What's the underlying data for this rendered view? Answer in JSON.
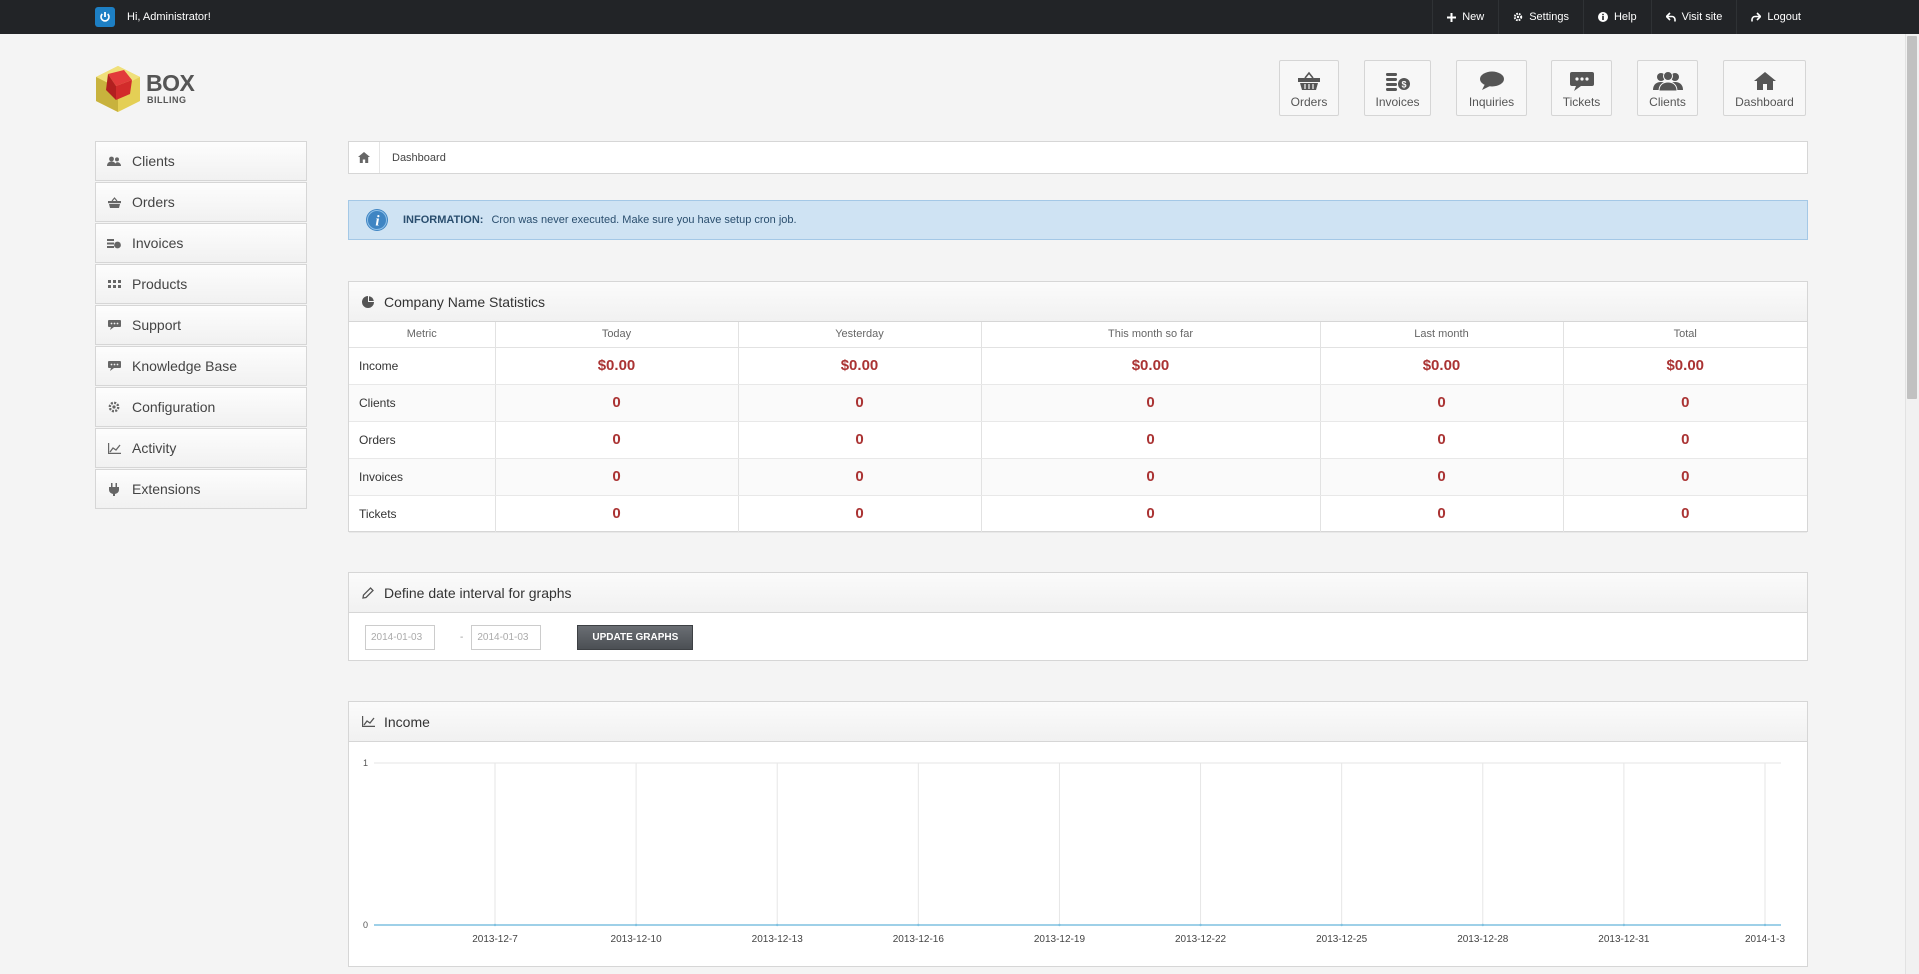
{
  "topbar": {
    "greeting": "Hi, Administrator!",
    "links": [
      {
        "label": "New",
        "icon": "plus-icon"
      },
      {
        "label": "Settings",
        "icon": "gear-icon"
      },
      {
        "label": "Help",
        "icon": "info-icon"
      },
      {
        "label": "Visit site",
        "icon": "back-arrow-icon"
      },
      {
        "label": "Logout",
        "icon": "logout-arrow-icon"
      }
    ]
  },
  "logo": {
    "line1": "BOX",
    "line2": "BILLING"
  },
  "quick_buttons": [
    {
      "label": "Orders",
      "icon": "basket-icon"
    },
    {
      "label": "Invoices",
      "icon": "coins-icon"
    },
    {
      "label": "Inquiries",
      "icon": "speech-bubble-icon"
    },
    {
      "label": "Tickets",
      "icon": "ticket-chat-icon"
    },
    {
      "label": "Clients",
      "icon": "users-icon"
    },
    {
      "label": "Dashboard",
      "icon": "home-icon"
    }
  ],
  "sidebar": {
    "items": [
      {
        "label": "Clients",
        "icon": "users-icon"
      },
      {
        "label": "Orders",
        "icon": "basket-icon"
      },
      {
        "label": "Invoices",
        "icon": "coins-icon"
      },
      {
        "label": "Products",
        "icon": "grid-icon"
      },
      {
        "label": "Support",
        "icon": "chat-icon"
      },
      {
        "label": "Knowledge Base",
        "icon": "chat-icon"
      },
      {
        "label": "Configuration",
        "icon": "gear-icon"
      },
      {
        "label": "Activity",
        "icon": "chart-line-icon"
      },
      {
        "label": "Extensions",
        "icon": "plug-icon"
      }
    ]
  },
  "breadcrumb": {
    "current": "Dashboard"
  },
  "info": {
    "label": "INFORMATION:",
    "message": "Cron was never executed. Make sure you have setup cron job."
  },
  "stats": {
    "title": "Company Name Statistics",
    "columns": [
      "Metric",
      "Today",
      "Yesterday",
      "This month so far",
      "Last month",
      "Total"
    ],
    "rows": [
      {
        "metric": "Income",
        "values": [
          "$0.00",
          "$0.00",
          "$0.00",
          "$0.00",
          "$0.00"
        ]
      },
      {
        "metric": "Clients",
        "values": [
          "0",
          "0",
          "0",
          "0",
          "0"
        ]
      },
      {
        "metric": "Orders",
        "values": [
          "0",
          "0",
          "0",
          "0",
          "0"
        ]
      },
      {
        "metric": "Invoices",
        "values": [
          "0",
          "0",
          "0",
          "0",
          "0"
        ]
      },
      {
        "metric": "Tickets",
        "values": [
          "0",
          "0",
          "0",
          "0",
          "0"
        ]
      }
    ]
  },
  "date_interval": {
    "title": "Define date interval for graphs",
    "from": "2014-01-03",
    "separator": "-",
    "to": "2014-01-03",
    "button": "UPDATE GRAPHS"
  },
  "income_chart": {
    "title": "Income",
    "chart_data": {
      "type": "line",
      "title": "Income",
      "x": [
        "2013-12-7",
        "2013-12-10",
        "2013-12-13",
        "2013-12-16",
        "2013-12-19",
        "2013-12-22",
        "2013-12-25",
        "2013-12-28",
        "2013-12-31",
        "2014-1-3"
      ],
      "series": [
        {
          "values": [
            0,
            0,
            0,
            0,
            0,
            0,
            0,
            0,
            0,
            0
          ]
        }
      ],
      "yticks": [
        "0",
        "1"
      ],
      "ylim": [
        0,
        1
      ],
      "grid": true,
      "line_color": "#7fc1e0"
    }
  }
}
